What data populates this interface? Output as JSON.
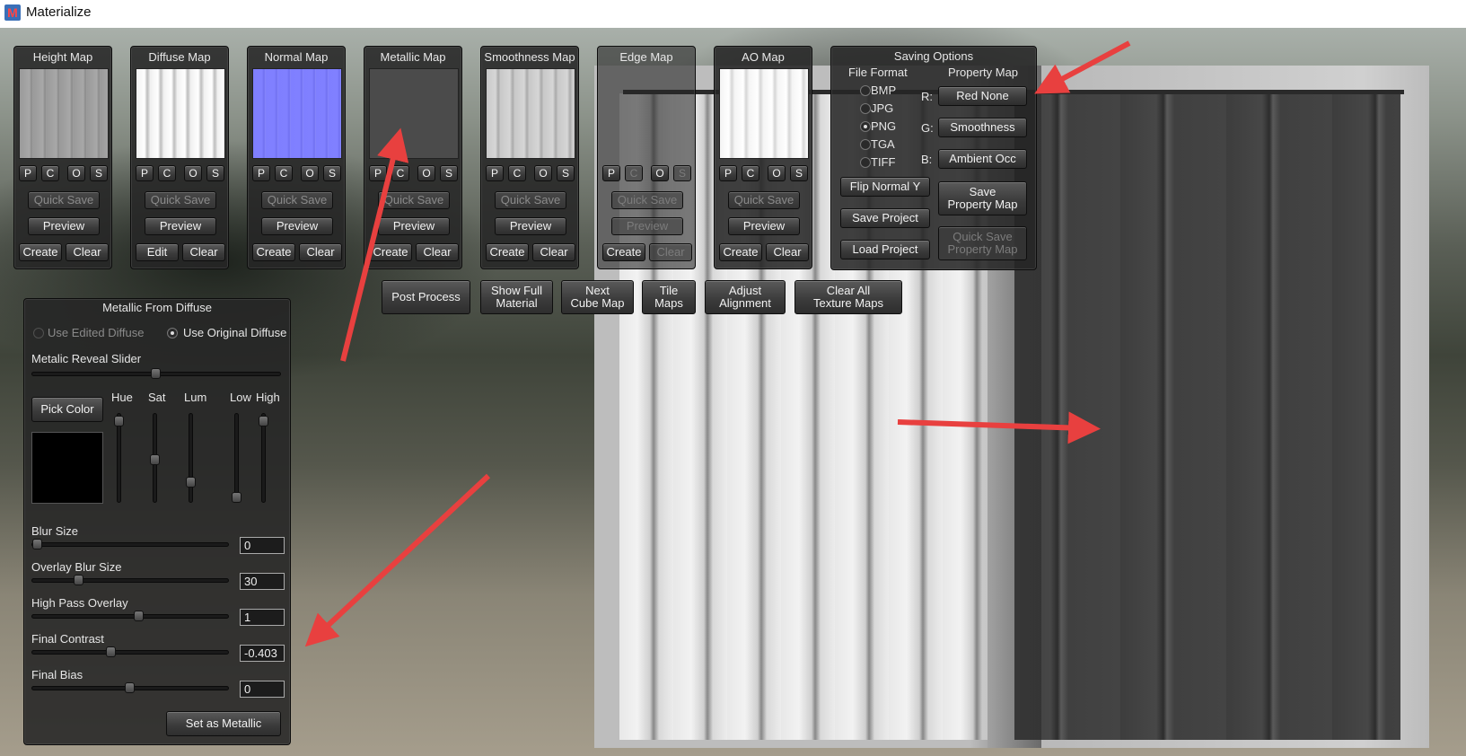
{
  "window": {
    "title": "Materialize",
    "icon": "M"
  },
  "maps": [
    {
      "title": "Height Map",
      "buttons": [
        "P",
        "C",
        "O",
        "S"
      ],
      "quick_save": "Quick Save",
      "preview": "Preview",
      "action1": "Create",
      "action2": "Clear"
    },
    {
      "title": "Diffuse Map",
      "buttons": [
        "P",
        "C",
        "O",
        "S"
      ],
      "quick_save": "Quick Save",
      "preview": "Preview",
      "action1": "Edit",
      "action2": "Clear"
    },
    {
      "title": "Normal Map",
      "buttons": [
        "P",
        "C",
        "O",
        "S"
      ],
      "quick_save": "Quick Save",
      "preview": "Preview",
      "action1": "Create",
      "action2": "Clear"
    },
    {
      "title": "Metallic Map",
      "buttons": [
        "P",
        "C",
        "O",
        "S"
      ],
      "quick_save": "Quick Save",
      "preview": "Preview",
      "action1": "Create",
      "action2": "Clear"
    },
    {
      "title": "Smoothness Map",
      "buttons": [
        "P",
        "C",
        "O",
        "S"
      ],
      "quick_save": "Quick Save",
      "preview": "Preview",
      "action1": "Create",
      "action2": "Clear"
    },
    {
      "title": "Edge Map",
      "buttons": [
        "P",
        "C",
        "O",
        "S"
      ],
      "quick_save": "Quick Save",
      "preview": "Preview",
      "action1": "Create",
      "action2": "Clear"
    },
    {
      "title": "AO Map",
      "buttons": [
        "P",
        "C",
        "O",
        "S"
      ],
      "quick_save": "Quick Save",
      "preview": "Preview",
      "action1": "Create",
      "action2": "Clear"
    }
  ],
  "saving": {
    "title": "Saving Options",
    "file_format_label": "File Format",
    "property_map_label": "Property Map",
    "formats": [
      "BMP",
      "JPG",
      "PNG",
      "TGA",
      "TIFF"
    ],
    "selected_format": "PNG",
    "channels": [
      {
        "label": "R:",
        "value": "Red None"
      },
      {
        "label": "G:",
        "value": "Smoothness"
      },
      {
        "label": "B:",
        "value": "Ambient Occ"
      }
    ],
    "flip_normal": "Flip Normal Y",
    "save_project": "Save Project",
    "load_project": "Load Project",
    "save_property_1": "Save",
    "save_property_2": "Property Map",
    "quick_save_property_1": "Quick Save",
    "quick_save_property_2": "Property Map"
  },
  "toolbar": {
    "post_process": "Post Process",
    "show_full_1": "Show Full",
    "show_full_2": "Material",
    "next_cube_1": "Next",
    "next_cube_2": "Cube Map",
    "tile_1": "Tile",
    "tile_2": "Maps",
    "adjust_1": "Adjust",
    "adjust_2": "Alignment",
    "clear_all_1": "Clear All",
    "clear_all_2": "Texture Maps"
  },
  "metallic": {
    "title": "Metallic From Diffuse",
    "use_edited": "Use Edited Diffuse",
    "use_original": "Use Original Diffuse",
    "reveal_label": "Metalic Reveal Slider",
    "reveal_value": 0.5,
    "pick_color": "Pick Color",
    "hsl_labels": {
      "hue": "Hue",
      "sat": "Sat",
      "lum": "Lum",
      "low": "Low",
      "high": "High"
    },
    "picked_color": "#000000",
    "sliders": [
      {
        "label": "Blur Size",
        "value": "0",
        "level": 0.0
      },
      {
        "label": "Overlay Blur Size",
        "value": "30",
        "level": 0.22
      },
      {
        "label": "High Pass Overlay",
        "value": "1",
        "level": 0.55
      },
      {
        "label": "Final Contrast",
        "value": "-0.403",
        "level": 0.4
      },
      {
        "label": "Final Bias",
        "value": "0",
        "level": 0.5
      }
    ],
    "set_as_metallic": "Set as Metallic"
  },
  "colors": {
    "annotation_arrow": "#e8403f"
  }
}
